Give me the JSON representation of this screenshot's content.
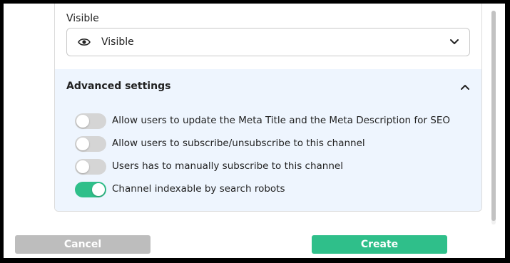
{
  "visibility": {
    "label": "Visible",
    "selected": "Visible",
    "icon": "eye-icon"
  },
  "advanced": {
    "title": "Advanced settings",
    "expanded": true,
    "options": [
      {
        "label": "Allow users to update the Meta Title and the Meta Description for SEO",
        "enabled": false
      },
      {
        "label": "Allow users to subscribe/unsubscribe to this channel",
        "enabled": false
      },
      {
        "label": "Users has to manually subscribe to this channel",
        "enabled": false
      },
      {
        "label": "Channel indexable by search robots",
        "enabled": true
      }
    ]
  },
  "buttons": {
    "cancel": "Cancel",
    "create": "Create"
  },
  "colors": {
    "accent": "#2fbf8a",
    "toggle_off": "#d5d5d5",
    "panel_bg": "#eef5fe",
    "cancel_bg": "#bdbdbd"
  }
}
